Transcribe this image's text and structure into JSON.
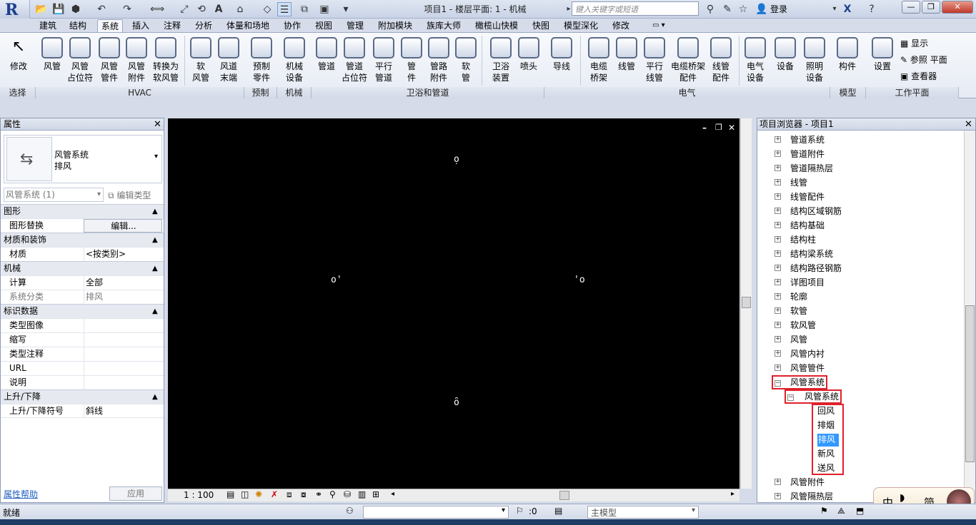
{
  "app": {
    "logo": "R",
    "title": "项目1 - 楼层平面: 1 - 机械",
    "search_placeholder": "键入关键字或短语",
    "login": "登录"
  },
  "tabs": [
    "建筑",
    "结构",
    "系统",
    "插入",
    "注释",
    "分析",
    "体量和场地",
    "协作",
    "视图",
    "管理",
    "附加模块",
    "族库大师",
    "橄榄山快模",
    "快图",
    "模型深化",
    "修改"
  ],
  "active_tab": "系统",
  "ribbon": {
    "select": {
      "button": "修改",
      "panel": "选择"
    },
    "hvac": {
      "buttons": [
        "风管",
        "风管\n占位符",
        "风管\n管件",
        "风管\n附件",
        "转换为\n软风管",
        "软\n风管",
        "风道\n末端"
      ],
      "panel": "HVAC"
    },
    "prefab": {
      "buttons": [
        "预制\n零件"
      ],
      "panel": "预制"
    },
    "mech": {
      "buttons": [
        "机械\n设备"
      ],
      "panel": "机械"
    },
    "plumbing": {
      "buttons": [
        "管道",
        "管道\n占位符",
        "平行\n管道",
        "管\n件",
        "管路\n附件",
        "软\n管",
        "卫浴\n装置",
        "喷头"
      ],
      "panel": "卫浴和管道"
    },
    "electrical": {
      "buttons": [
        "导线",
        "电缆\n桥架",
        "线管",
        "平行\n线管",
        "电缆桥架\n配件",
        "线管\n配件",
        "电气\n设备",
        "设备",
        "照明\n设备"
      ],
      "panel": "电气"
    },
    "model": {
      "buttons": [
        "构件"
      ],
      "panel": "模型"
    },
    "workplane": {
      "button": "设置",
      "small": [
        "显示",
        "参照 平面",
        "查看器"
      ],
      "panel": "工作平面"
    }
  },
  "properties": {
    "header": "属性",
    "type_name": "风管系统",
    "type_sub": "排风",
    "filter": "风管系统 (1)",
    "edit_type": "编辑类型",
    "sections": [
      {
        "title": "图形",
        "rows": [
          {
            "k": "图形替换",
            "v": "编辑..."
          }
        ]
      },
      {
        "title": "材质和装饰",
        "rows": [
          {
            "k": "材质",
            "v": "<按类别>"
          }
        ]
      },
      {
        "title": "机械",
        "rows": [
          {
            "k": "计算",
            "v": "全部"
          },
          {
            "k": "系统分类",
            "v": "排风"
          }
        ]
      },
      {
        "title": "标识数据",
        "rows": [
          {
            "k": "类型图像",
            "v": ""
          },
          {
            "k": "缩写",
            "v": ""
          },
          {
            "k": "类型注释",
            "v": ""
          },
          {
            "k": "URL",
            "v": ""
          },
          {
            "k": "说明",
            "v": ""
          }
        ]
      },
      {
        "title": "上升/下降",
        "rows": [
          {
            "k": "上升/下降符号",
            "v": "斜线"
          }
        ]
      }
    ],
    "help_link": "属性帮助",
    "apply": "应用"
  },
  "canvas": {
    "scale": "1 : 100"
  },
  "browser": {
    "header": "项目浏览器 - 项目1",
    "items": [
      "管道系统",
      "管道附件",
      "管道隔热层",
      "线管",
      "线管配件",
      "结构区域钢筋",
      "结构基础",
      "结构柱",
      "结构梁系统",
      "结构路径钢筋",
      "详图项目",
      "轮廓",
      "软管",
      "软风管",
      "风管",
      "风管内衬",
      "风管管件"
    ],
    "expanded": "风管系统",
    "expanded_child": "风管系统",
    "leaf_items": [
      "回风",
      "排烟",
      "排风",
      "新风",
      "送风"
    ],
    "selected": "排风",
    "after_items": [
      "风管附件",
      "风管隔热层"
    ]
  },
  "status": {
    "left": "就绪",
    "count": ":0",
    "model": "主模型"
  },
  "ime": {
    "label": "中",
    "mode": "简"
  },
  "colors": {
    "highlight": "#3399ff",
    "annotation": "#e0202a"
  }
}
